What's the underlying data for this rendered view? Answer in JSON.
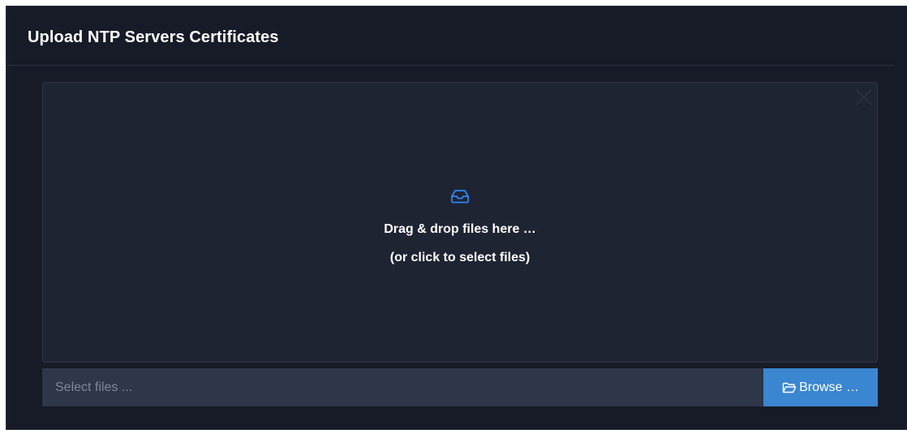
{
  "panel": {
    "title": "Upload NTP Servers Certificates"
  },
  "dropzone": {
    "icon": "inbox-icon",
    "line1": "Drag & drop files here …",
    "line2": "(or click to select files)",
    "close_icon": "close-icon"
  },
  "file_input": {
    "placeholder": "Select files ...",
    "value": ""
  },
  "browse_button": {
    "icon": "folder-open-icon",
    "label": "Browse …"
  },
  "colors": {
    "panel_bg": "#161b27",
    "dropzone_bg": "#1f2433",
    "input_bg": "#2e3649",
    "accent": "#3b86d1",
    "icon_blue": "#2f86f6"
  }
}
